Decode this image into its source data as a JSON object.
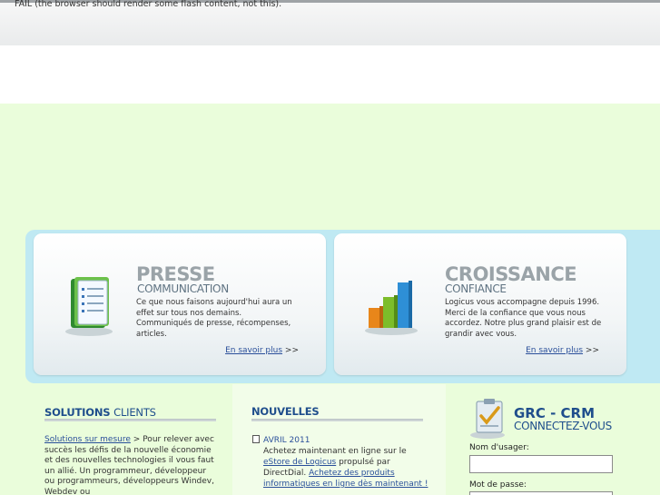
{
  "fallback": {
    "text": "FAIL (the browser should render some flash content, not this)."
  },
  "cards": [
    {
      "title": "PRESSE",
      "subtitle": "COMMUNICATION",
      "text": "Ce que nous faisons aujourd'hui aura un effet sur tous nos demains. Communiqués de presse, récompenses, articles.",
      "link_label": "En savoir plus",
      "link_suffix": ">>",
      "icon": "book-icon"
    },
    {
      "title": "CROISSANCE",
      "subtitle": "CONFIANCE",
      "text": "Logicus vous accompagne depuis 1996. Merci de la confiance que vous nous accordez. Notre plus grand plaisir est de grandir avec vous.",
      "link_label": "En savoir plus",
      "link_suffix": ">>",
      "icon": "bar-chart-icon"
    }
  ],
  "solutions": {
    "heading_bold": "SOLUTIONS",
    "heading_light": "CLIENTS",
    "link_label": "Solutions sur mesure",
    "link_suffix": ">",
    "text": "Pour relever avec succès les défis de la nouvelle économie et des nouvelles technologies il vous faut un allié. Un programmeur, développeur ou programmeurs, développeurs Windev, Webdev ou"
  },
  "news": {
    "heading": "NOUVELLES",
    "items": [
      {
        "date": "AVRIL 2011",
        "text_1": "Achetez maintenant en ligne sur le",
        "link_1": "eStore de Logicus",
        "text_2": "propulsé par DirectDial.",
        "link_2": "Achetez des produits informatiques en ligne dès maintenant !"
      }
    ]
  },
  "crm": {
    "title": "GRC - CRM",
    "subtitle": "CONNECTEZ-VOUS",
    "username_label": "Nom d'usager:",
    "username_value": "",
    "password_label": "Mot de passe:",
    "password_value": "",
    "icon": "clipboard-check-icon"
  },
  "colors": {
    "accent": "#1f4e8c",
    "link": "#2a4f9a",
    "page_green": "#eafddb",
    "frame_blue": "#bfe9f3",
    "chart_bars": [
      "#e8861a",
      "#7cbd2a",
      "#2e8fd6"
    ]
  }
}
